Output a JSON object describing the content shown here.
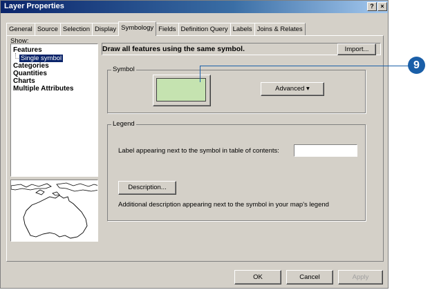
{
  "window": {
    "title": "Layer Properties",
    "help_glyph": "?",
    "close_glyph": "×"
  },
  "tabs": [
    "General",
    "Source",
    "Selection",
    "Display",
    "Symbology",
    "Fields",
    "Definition Query",
    "Labels",
    "Joins & Relates"
  ],
  "active_tab": "Symbology",
  "show": {
    "label": "Show:",
    "items": [
      "Features",
      "Single symbol",
      "Categories",
      "Quantities",
      "Charts",
      "Multiple Attributes"
    ],
    "selected": "Single symbol"
  },
  "header": {
    "description": "Draw all features using the same symbol.",
    "import_label": "Import..."
  },
  "symbol_group": {
    "label": "Symbol",
    "fill_color": "#c5e3b0",
    "advanced_label": "Advanced ▾"
  },
  "legend_group": {
    "label": "Legend",
    "label_prompt": "Label appearing next to the symbol in table of contents:",
    "label_value": "",
    "description_label": "Description...",
    "description_help": "Additional description appearing next to the symbol in your map's legend"
  },
  "footer": {
    "ok_label": "OK",
    "cancel_label": "Cancel",
    "apply_label": "Apply"
  },
  "callout": {
    "number": "9",
    "color": "#1a5fa8"
  }
}
